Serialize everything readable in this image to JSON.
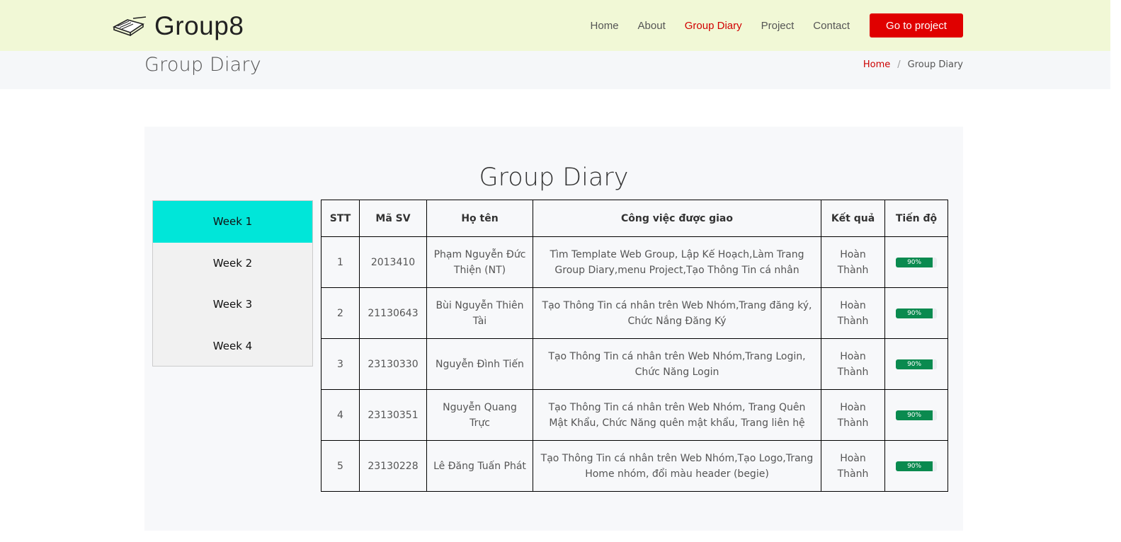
{
  "brand": {
    "name": "Group8",
    "icon": "book-icon"
  },
  "nav": {
    "items": [
      {
        "label": "Home",
        "active": false
      },
      {
        "label": "About",
        "active": false
      },
      {
        "label": "Group Diary",
        "active": true
      },
      {
        "label": "Project",
        "active": false
      },
      {
        "label": "Contact",
        "active": false
      }
    ],
    "cta_label": "Go to project"
  },
  "page": {
    "title": "Group Diary",
    "breadcrumb": {
      "home": "Home",
      "separator": "/",
      "current": "Group Diary"
    }
  },
  "section": {
    "title": "Group Diary",
    "weeks": [
      "Week 1",
      "Week 2",
      "Week 3",
      "Week 4"
    ],
    "active_week": "Week 1"
  },
  "table": {
    "headers": [
      "STT",
      "Mã SV",
      "Họ tên",
      "Công việc được giao",
      "Kết quả",
      "Tiến độ"
    ],
    "rows": [
      {
        "stt": "1",
        "ma_sv": "2013410",
        "ho_ten": "Phạm Nguyễn Đức Thiện (NT)",
        "cong_viec": "Tìm Template Web Group, Lập Kế Hoạch,Làm Trang Group Diary,menu Project,Tạo Thông Tin cá nhân",
        "ket_qua": "Hoàn Thành",
        "tien_do": "90%",
        "tien_do_value": 90
      },
      {
        "stt": "2",
        "ma_sv": "21130643",
        "ho_ten": "Bùi Nguyễn Thiên Tài",
        "cong_viec": "Tạo Thông Tin cá nhân trên Web Nhóm,Trang đăng ký, Chức Nắng Đăng Ký",
        "ket_qua": "Hoàn Thành",
        "tien_do": "90%",
        "tien_do_value": 90
      },
      {
        "stt": "3",
        "ma_sv": "23130330",
        "ho_ten": "Nguyễn Đình Tiến",
        "cong_viec": "Tạo Thông Tin cá nhân trên Web Nhóm,Trang Login, Chức Năng Login",
        "ket_qua": "Hoàn Thành",
        "tien_do": "90%",
        "tien_do_value": 90
      },
      {
        "stt": "4",
        "ma_sv": "23130351",
        "ho_ten": "Nguyễn Quang Trực",
        "cong_viec": "Tạo Thông Tin cá nhân trên Web Nhóm, Trang Quên Mật Khẩu, Chức Năng quên mật khẩu, Trang liên hệ",
        "ket_qua": "Hoàn Thành",
        "tien_do": "90%",
        "tien_do_value": 90
      },
      {
        "stt": "5",
        "ma_sv": "23130228",
        "ho_ten": "Lê Đăng Tuấn Phát",
        "cong_viec": "Tạo Thông Tin cá nhân trên Web Nhóm,Tạo Logo,Trang Home nhóm, đổi màu header (begie)",
        "ket_qua": "Hoàn Thành",
        "tien_do": "90%",
        "tien_do_value": 90
      }
    ]
  },
  "colors": {
    "header_bg": "#f1f8d6",
    "accent": "#e00000",
    "active_week": "#00e6d9",
    "progress": "#0a8a4f"
  }
}
